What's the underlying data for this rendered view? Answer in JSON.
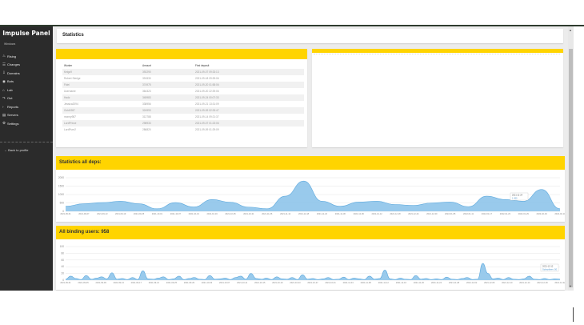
{
  "app": {
    "brand": "Impulse Panel",
    "page_title": "Statistics"
  },
  "sidebar": {
    "heading": "Windows",
    "items": [
      {
        "icon": "flame-icon",
        "glyph": "♨",
        "label": "Rising"
      },
      {
        "icon": "graph-icon",
        "glyph": "☰",
        "label": "Changes"
      },
      {
        "icon": "download-icon",
        "glyph": "⇩",
        "label": "Domains"
      },
      {
        "icon": "eye-icon",
        "glyph": "◉",
        "label": "Bots"
      },
      {
        "icon": "home-icon",
        "glyph": "⌂",
        "label": "Lab"
      },
      {
        "icon": "share-icon",
        "glyph": "↷",
        "label": "Out"
      },
      {
        "icon": "arrow-icon",
        "glyph": "›",
        "label": "Reports"
      },
      {
        "icon": "server-icon",
        "glyph": "▤",
        "label": "Servers"
      },
      {
        "icon": "gear-icon",
        "glyph": "⚙",
        "label": "Settings"
      }
    ],
    "back": "Back to profile"
  },
  "table": {
    "headers": [
      "Worker",
      "Amount",
      "First deposit"
    ],
    "rows": [
      [
        "Keigo9",
        "392290",
        "2021-09-07 09:33:13"
      ],
      [
        "Robert Sterlge",
        "391530",
        "2021-09-18 09:39:06"
      ],
      [
        "Fidel",
        "374975",
        "2021-09-20 01:58:06"
      ],
      [
        "Username",
        "364323",
        "2021-09-20 22:39:06"
      ],
      [
        "Hadz",
        "345983",
        "2021-09-24 00:07:33"
      ],
      [
        "Jessica2094",
        "338956",
        "2021-09-21 13:31:09"
      ],
      [
        "Gold1987",
        "324993",
        "2021-09-09 02:33:47"
      ],
      [
        "money987",
        "312788",
        "2021-09-14 09:21:37"
      ],
      [
        "LordPrince",
        "298933",
        "2021-09-07 01:23:06"
      ],
      [
        "LordPure2",
        "286820",
        "2021-09-09 01:29:09"
      ]
    ]
  },
  "charts": {
    "deps": {
      "title": "Statistics all deps:"
    },
    "binding": {
      "title": "All binding users: 958"
    }
  },
  "chart_data": [
    {
      "type": "area",
      "title": "Statistics all deps:",
      "yticks": [
        "2000",
        "1500",
        "1000",
        "500",
        "0"
      ],
      "ylim": [
        0,
        2000
      ],
      "x": [
        "2021-09-01",
        "2021-09-04",
        "2021-09-07",
        "2021-09-10",
        "2021-09-13",
        "2021-09-16",
        "2021-09-19",
        "2021-09-22",
        "2021-09-25",
        "2021-09-28",
        "2021-10-01",
        "2021-10-04",
        "2021-10-07",
        "2021-10-10",
        "2021-10-13",
        "2021-10-16",
        "2021-10-19",
        "2021-10-22",
        "2021-10-25",
        "2021-10-28",
        "2021-10-31",
        "2021-11-03",
        "2021-11-06",
        "2021-11-09",
        "2021-11-12",
        "2021-11-15",
        "2021-11-18",
        "2021-11-21"
      ],
      "xlabels": [
        "2021-09-01",
        "2021-09-07",
        "2021-09-13",
        "2021-09-19",
        "2021-09-25",
        "2021-10-01",
        "2021-10-07",
        "2021-10-13",
        "2021-10-19",
        "2021-10-25",
        "2021-10-31",
        "2021-11-06",
        "2021-11-12",
        "2021-11-18",
        "2021-11-24",
        "2021-11-30",
        "2021-12-06",
        "2021-12-12",
        "2021-12-18",
        "2021-12-24",
        "2021-12-30",
        "2022-01-05",
        "2022-01-11",
        "2022-01-17",
        "2022-01-23",
        "2022-01-29",
        "2022-02-04",
        "2022-02-10"
      ],
      "values": [
        300,
        450,
        520,
        600,
        450,
        150,
        520,
        260,
        700,
        540,
        250,
        150,
        900,
        1800,
        600,
        300,
        550,
        600,
        400,
        350,
        500,
        550,
        280,
        900,
        700,
        600,
        1300,
        150
      ],
      "tooltip": {
        "date": "2021-11-24",
        "value": "1 450"
      }
    },
    {
      "type": "area",
      "title": "All binding users: 958",
      "yticks": [
        "100",
        "80",
        "60",
        "40",
        "20",
        "0"
      ],
      "ylim": [
        0,
        100
      ],
      "xlabels": [
        "2021-09-01",
        "2021-09-05",
        "2021-09-09",
        "2021-09-13",
        "2021-09-17",
        "2021-09-21",
        "2021-09-25",
        "2021-09-29",
        "2021-10-03",
        "2021-10-07",
        "2021-10-11",
        "2021-10-15",
        "2021-10-19",
        "2021-10-23",
        "2021-10-27",
        "2021-10-31",
        "2021-11-04",
        "2021-11-08",
        "2021-11-12",
        "2021-11-16",
        "2021-11-20",
        "2021-11-24",
        "2021-11-28",
        "2021-12-02",
        "2021-12-06",
        "2021-12-10",
        "2021-12-14",
        "2021-12-18",
        "2021-12-22"
      ],
      "values": [
        3,
        12,
        5,
        2,
        14,
        3,
        6,
        10,
        4,
        22,
        3,
        5,
        2,
        8,
        2,
        28,
        4,
        3,
        6,
        10,
        2,
        4,
        12,
        2,
        5,
        8,
        3,
        2,
        14,
        3,
        4,
        6,
        2,
        8,
        12,
        3,
        20,
        5,
        3,
        6,
        2,
        10,
        4,
        3,
        8,
        2,
        16,
        3,
        5,
        2,
        4,
        8,
        2,
        3,
        9,
        2,
        6,
        4,
        2,
        12,
        3,
        5,
        30,
        4,
        2,
        6,
        3,
        2,
        14,
        3,
        5,
        2,
        4,
        2,
        9,
        3,
        2,
        5,
        8,
        2,
        3,
        50,
        20,
        4,
        6,
        2,
        8,
        3,
        2,
        4,
        12,
        3,
        2,
        5,
        2,
        4,
        3
      ],
      "tooltip": {
        "date": "2021-12-12",
        "value": "Subscribers: 50"
      }
    }
  ]
}
